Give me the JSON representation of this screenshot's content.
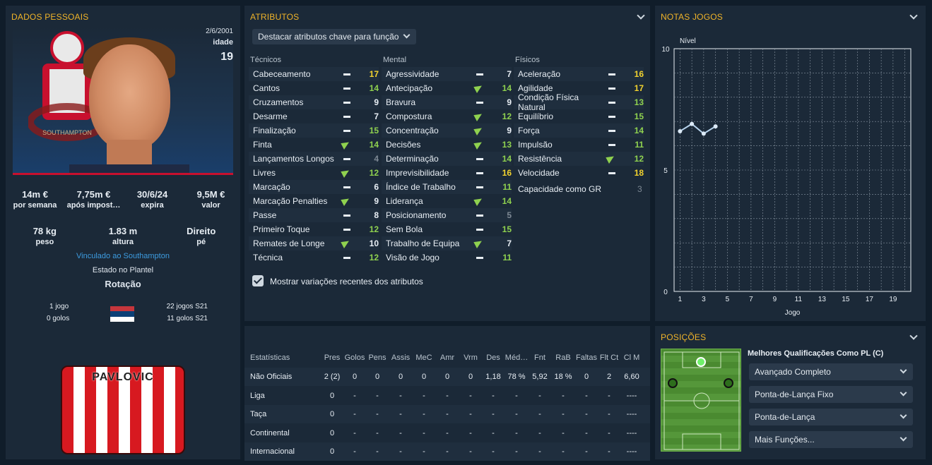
{
  "personal": {
    "title": "DADOS PESSOAIS",
    "birth_date": "2/6/2001",
    "age_label": "idade",
    "age": "19",
    "contract": [
      {
        "value": "14m €",
        "label": "por semana"
      },
      {
        "value": "7,75m €",
        "label": "após impost…"
      },
      {
        "value": "30/6/24",
        "label": "expira"
      },
      {
        "value": "9,5M €",
        "label": "valor"
      }
    ],
    "physical": [
      {
        "value": "78 kg",
        "label": "peso"
      },
      {
        "value": "1.83 m",
        "label": "altura"
      },
      {
        "value": "Direito",
        "label": "pé"
      }
    ],
    "linked": "Vinculado ao Southampton",
    "squad_status_label": "Estado no Plantel",
    "squad_status": "Rotação",
    "intl_caps": "1 jogo",
    "intl_goals": "0 golos",
    "u21_caps": "22 jogos S21",
    "u21_goals": "11 golos S21",
    "shirt_name": "PAVLOVIC"
  },
  "attributes": {
    "title": "ATRIBUTOS",
    "highlight_dropdown": "Destacar atributos chave para função",
    "technical_header": "Técnicos",
    "mental_header": "Mental",
    "physical_header": "Físicos",
    "technical": [
      {
        "name": "Cabeceamento",
        "trend": "dash",
        "value": "17"
      },
      {
        "name": "Cantos",
        "trend": "dash",
        "value": "14"
      },
      {
        "name": "Cruzamentos",
        "trend": "dash",
        "value": "9"
      },
      {
        "name": "Desarme",
        "trend": "dash",
        "value": "7"
      },
      {
        "name": "Finalização",
        "trend": "dash",
        "value": "15"
      },
      {
        "name": "Finta",
        "trend": "up",
        "value": "14"
      },
      {
        "name": "Lançamentos Longos",
        "trend": "dash",
        "value": "4"
      },
      {
        "name": "Livres",
        "trend": "up",
        "value": "12"
      },
      {
        "name": "Marcação",
        "trend": "dash",
        "value": "6"
      },
      {
        "name": "Marcação Penalties",
        "trend": "up",
        "value": "9"
      },
      {
        "name": "Passe",
        "trend": "dash",
        "value": "8"
      },
      {
        "name": "Primeiro Toque",
        "trend": "dash",
        "value": "12"
      },
      {
        "name": "Remates de Longe",
        "trend": "up",
        "value": "10"
      },
      {
        "name": "Técnica",
        "trend": "dash",
        "value": "12"
      }
    ],
    "mental": [
      {
        "name": "Agressividade",
        "trend": "dash",
        "value": "7"
      },
      {
        "name": "Antecipação",
        "trend": "up",
        "value": "14"
      },
      {
        "name": "Bravura",
        "trend": "dash",
        "value": "9"
      },
      {
        "name": "Compostura",
        "trend": "up",
        "value": "12"
      },
      {
        "name": "Concentração",
        "trend": "up",
        "value": "9"
      },
      {
        "name": "Decisões",
        "trend": "up",
        "value": "13"
      },
      {
        "name": "Determinação",
        "trend": "dash",
        "value": "14"
      },
      {
        "name": "Imprevisibilidade",
        "trend": "dash",
        "value": "16"
      },
      {
        "name": "Índice de Trabalho",
        "trend": "dash",
        "value": "11"
      },
      {
        "name": "Liderança",
        "trend": "up",
        "value": "14"
      },
      {
        "name": "Posicionamento",
        "trend": "dash",
        "value": "5"
      },
      {
        "name": "Sem Bola",
        "trend": "dash",
        "value": "15"
      },
      {
        "name": "Trabalho de Equipa",
        "trend": "up",
        "value": "7"
      },
      {
        "name": "Visão de Jogo",
        "trend": "dash",
        "value": "11"
      }
    ],
    "physical": [
      {
        "name": "Aceleração",
        "trend": "dash",
        "value": "16"
      },
      {
        "name": "Agilidade",
        "trend": "dash",
        "value": "17"
      },
      {
        "name": "Condição Física Natural",
        "trend": "dash",
        "value": "13"
      },
      {
        "name": "Equilíbrio",
        "trend": "dash",
        "value": "15"
      },
      {
        "name": "Força",
        "trend": "dash",
        "value": "14"
      },
      {
        "name": "Impulsão",
        "trend": "dash",
        "value": "11"
      },
      {
        "name": "Resistência",
        "trend": "up",
        "value": "12"
      },
      {
        "name": "Velocidade",
        "trend": "dash",
        "value": "18"
      }
    ],
    "gk_label": "Capacidade como GR",
    "gk_value": "3",
    "show_changes_label": "Mostrar variações recentes dos atributos",
    "show_changes_checked": true
  },
  "stats": {
    "headers": [
      "Estatísticas",
      "Pres",
      "Golos",
      "Pens",
      "Assis",
      "MeC",
      "Amr",
      "Vrm",
      "Des",
      "Méd…",
      "Fnt",
      "RaB",
      "Faltas",
      "Flt Ct",
      "Cl M"
    ],
    "rows": [
      [
        "Não Oficiais",
        "2 (2)",
        "0",
        "0",
        "0",
        "0",
        "0",
        "0",
        "1,18",
        "78 %",
        "5,92",
        "18 %",
        "0",
        "2",
        "6,60"
      ],
      [
        "Liga",
        "0",
        "-",
        "-",
        "-",
        "-",
        "-",
        "-",
        "-",
        "-",
        "-",
        "-",
        "-",
        "-",
        "----"
      ],
      [
        "Taça",
        "0",
        "-",
        "-",
        "-",
        "-",
        "-",
        "-",
        "-",
        "-",
        "-",
        "-",
        "-",
        "-",
        "----"
      ],
      [
        "Continental",
        "0",
        "-",
        "-",
        "-",
        "-",
        "-",
        "-",
        "-",
        "-",
        "-",
        "-",
        "-",
        "-",
        "----"
      ],
      [
        "Internacional",
        "0",
        "-",
        "-",
        "-",
        "-",
        "-",
        "-",
        "-",
        "-",
        "-",
        "-",
        "-",
        "-",
        "----"
      ]
    ]
  },
  "ratings": {
    "title": "NOTAS JOGOS",
    "chart_data": {
      "type": "line",
      "ylabel": "Nível",
      "xlabel": "Jogo",
      "ylim": [
        0,
        10
      ],
      "xlim": [
        1,
        20
      ],
      "y_ticks": [
        "0",
        "5",
        "10"
      ],
      "x_ticks": [
        "1",
        "3",
        "5",
        "7",
        "9",
        "11",
        "13",
        "15",
        "17",
        "19"
      ],
      "grid": true,
      "series": [
        {
          "x": [
            1,
            2,
            3,
            4
          ],
          "values": [
            6.6,
            6.9,
            6.5,
            6.8
          ]
        }
      ]
    }
  },
  "positions": {
    "title": "POSIÇÕES",
    "best_label": "Melhores Qualificações Como PL (C)",
    "roles": [
      "Avançado Completo",
      "Ponta-de-Lança Fixo",
      "Ponta-de-Lança",
      "Mais Funções..."
    ]
  },
  "colors": {
    "accent": "#f0b429",
    "high": "#f2d22e",
    "mid": "#8fd14f",
    "low": "#e8eef4",
    "dim": "#7d8893"
  }
}
